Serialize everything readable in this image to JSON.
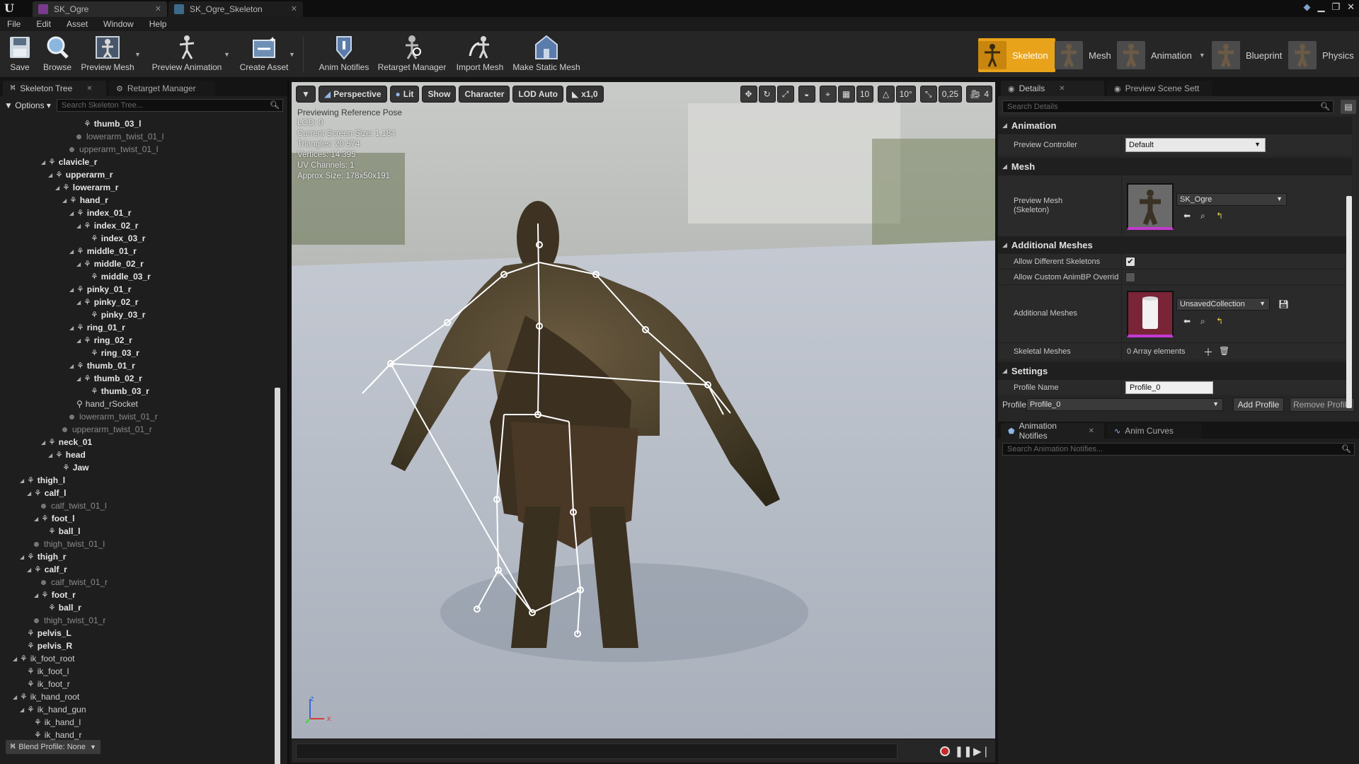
{
  "titlebar": {
    "tabs": [
      {
        "label": "SK_Ogre",
        "active": true
      },
      {
        "label": "SK_Ogre_Skeleton",
        "active": false
      }
    ]
  },
  "menu": [
    "File",
    "Edit",
    "Asset",
    "Window",
    "Help"
  ],
  "toolbar": {
    "save": "Save",
    "browse": "Browse",
    "preview_mesh": "Preview Mesh",
    "preview_animation": "Preview Animation",
    "create_asset": "Create Asset",
    "anim_notifies": "Anim Notifies",
    "retarget_manager": "Retarget Manager",
    "import_mesh": "Import Mesh",
    "make_static_mesh": "Make Static Mesh"
  },
  "modes": {
    "skeleton": "Skeleton",
    "mesh": "Mesh",
    "animation": "Animation",
    "blueprint": "Blueprint",
    "physics": "Physics"
  },
  "left_panel": {
    "tab_skeleton_tree": "Skeleton Tree",
    "tab_retarget_manager": "Retarget Manager",
    "options": "Options",
    "search_placeholder": "Search Skeleton Tree...",
    "blend_profile": "Blend Profile: None",
    "tree": [
      {
        "label": "thumb_03_l",
        "kind": "bone",
        "indent": 9,
        "arrow": false
      },
      {
        "label": "lowerarm_twist_01_l",
        "kind": "twist",
        "indent": 8,
        "arrow": false
      },
      {
        "label": "upperarm_twist_01_l",
        "kind": "twist",
        "indent": 7,
        "arrow": false
      },
      {
        "label": "clavicle_r",
        "kind": "bone",
        "indent": 4,
        "arrow": true
      },
      {
        "label": "upperarm_r",
        "kind": "bone",
        "indent": 5,
        "arrow": true
      },
      {
        "label": "lowerarm_r",
        "kind": "bone",
        "indent": 6,
        "arrow": true
      },
      {
        "label": "hand_r",
        "kind": "bone",
        "indent": 7,
        "arrow": true
      },
      {
        "label": "index_01_r",
        "kind": "bone",
        "indent": 8,
        "arrow": true
      },
      {
        "label": "index_02_r",
        "kind": "bone",
        "indent": 9,
        "arrow": true
      },
      {
        "label": "index_03_r",
        "kind": "bone",
        "indent": 10,
        "arrow": false
      },
      {
        "label": "middle_01_r",
        "kind": "bone",
        "indent": 8,
        "arrow": true
      },
      {
        "label": "middle_02_r",
        "kind": "bone",
        "indent": 9,
        "arrow": true
      },
      {
        "label": "middle_03_r",
        "kind": "bone",
        "indent": 10,
        "arrow": false
      },
      {
        "label": "pinky_01_r",
        "kind": "bone",
        "indent": 8,
        "arrow": true
      },
      {
        "label": "pinky_02_r",
        "kind": "bone",
        "indent": 9,
        "arrow": true
      },
      {
        "label": "pinky_03_r",
        "kind": "bone",
        "indent": 10,
        "arrow": false
      },
      {
        "label": "ring_01_r",
        "kind": "bone",
        "indent": 8,
        "arrow": true
      },
      {
        "label": "ring_02_r",
        "kind": "bone",
        "indent": 9,
        "arrow": true
      },
      {
        "label": "ring_03_r",
        "kind": "bone",
        "indent": 10,
        "arrow": false
      },
      {
        "label": "thumb_01_r",
        "kind": "bone",
        "indent": 8,
        "arrow": true
      },
      {
        "label": "thumb_02_r",
        "kind": "bone",
        "indent": 9,
        "arrow": true
      },
      {
        "label": "thumb_03_r",
        "kind": "bone",
        "indent": 10,
        "arrow": false
      },
      {
        "label": "hand_rSocket",
        "kind": "socket",
        "indent": 8,
        "arrow": false
      },
      {
        "label": "lowerarm_twist_01_r",
        "kind": "twist",
        "indent": 7,
        "arrow": false
      },
      {
        "label": "upperarm_twist_01_r",
        "kind": "twist",
        "indent": 6,
        "arrow": false
      },
      {
        "label": "neck_01",
        "kind": "bone",
        "indent": 4,
        "arrow": true
      },
      {
        "label": "head",
        "kind": "bone",
        "indent": 5,
        "arrow": true
      },
      {
        "label": "Jaw",
        "kind": "bone",
        "indent": 6,
        "arrow": false
      },
      {
        "label": "thigh_l",
        "kind": "bone",
        "indent": 1,
        "arrow": true
      },
      {
        "label": "calf_l",
        "kind": "bone",
        "indent": 2,
        "arrow": true
      },
      {
        "label": "calf_twist_01_l",
        "kind": "twist",
        "indent": 3,
        "arrow": false
      },
      {
        "label": "foot_l",
        "kind": "bone",
        "indent": 3,
        "arrow": true
      },
      {
        "label": "ball_l",
        "kind": "bone",
        "indent": 4,
        "arrow": false
      },
      {
        "label": "thigh_twist_01_l",
        "kind": "twist",
        "indent": 2,
        "arrow": false
      },
      {
        "label": "thigh_r",
        "kind": "bone",
        "indent": 1,
        "arrow": true
      },
      {
        "label": "calf_r",
        "kind": "bone",
        "indent": 2,
        "arrow": true
      },
      {
        "label": "calf_twist_01_r",
        "kind": "twist",
        "indent": 3,
        "arrow": false
      },
      {
        "label": "foot_r",
        "kind": "bone",
        "indent": 3,
        "arrow": true
      },
      {
        "label": "ball_r",
        "kind": "bone",
        "indent": 4,
        "arrow": false
      },
      {
        "label": "thigh_twist_01_r",
        "kind": "twist",
        "indent": 2,
        "arrow": false
      },
      {
        "label": "pelvis_L",
        "kind": "bone",
        "indent": 1,
        "arrow": false
      },
      {
        "label": "pelvis_R",
        "kind": "bone",
        "indent": 1,
        "arrow": false
      },
      {
        "label": "ik_foot_root",
        "kind": "socket",
        "indent": 0,
        "arrow": true
      },
      {
        "label": "ik_foot_l",
        "kind": "socket",
        "indent": 1,
        "arrow": false
      },
      {
        "label": "ik_foot_r",
        "kind": "socket",
        "indent": 1,
        "arrow": false
      },
      {
        "label": "ik_hand_root",
        "kind": "socket",
        "indent": 0,
        "arrow": true
      },
      {
        "label": "ik_hand_gun",
        "kind": "socket",
        "indent": 1,
        "arrow": true
      },
      {
        "label": "ik_hand_l",
        "kind": "socket",
        "indent": 2,
        "arrow": false
      },
      {
        "label": "ik_hand_r",
        "kind": "socket",
        "indent": 2,
        "arrow": false
      }
    ]
  },
  "viewport": {
    "perspective": "Perspective",
    "lit": "Lit",
    "show": "Show",
    "character": "Character",
    "lod": "LOD Auto",
    "speed": "x1,0",
    "grid_snap": "10",
    "rot_snap": "10°",
    "scale_snap": "0,25",
    "cam_speed": "4",
    "info": {
      "title": "Previewing Reference Pose",
      "lod": "LOD: 0",
      "screen_size": "Current Screen Size: 1,184",
      "triangles": "Triangles: 20 574",
      "vertices": "Vertices: 14 395",
      "uv_channels": "UV Channels: 1",
      "approx_size": "Approx Size: 178x50x191"
    },
    "axis_x": "x",
    "axis_z": "z"
  },
  "right_panel": {
    "tab_details": "Details",
    "tab_preview_scene": "Preview Scene Sett",
    "search_placeholder": "Search Details",
    "cat_animation": "Animation",
    "preview_controller_label": "Preview Controller",
    "preview_controller_value": "Default",
    "cat_mesh": "Mesh",
    "preview_mesh_label": "Preview Mesh\n(Skeleton)",
    "preview_mesh_value": "SK_Ogre",
    "cat_additional": "Additional Meshes",
    "allow_diff_label": "Allow Different Skeletons",
    "allow_custom_label": "Allow Custom AnimBP Overrid",
    "additional_meshes_label": "Additional Meshes",
    "collection_value": "UnsavedCollection",
    "skeletal_meshes_label": "Skeletal Meshes",
    "array_value": "0 Array elements",
    "cat_settings": "Settings",
    "profile_name_label": "Profile Name",
    "profile_name_value": "Profile_0",
    "profile_label": "Profile",
    "profile_value": "Profile_0",
    "add_profile": "Add Profile",
    "remove_profile": "Remove Profile",
    "tab_anim_notifies": "Animation Notifies",
    "tab_anim_curves": "Anim Curves",
    "notifies_search_placeholder": "Search Animation Notifies..."
  },
  "colors": {
    "accent_active_mode": "#e8a31a",
    "bone_lines": "#ffffff",
    "thumb_underline": "#c33ad0"
  }
}
